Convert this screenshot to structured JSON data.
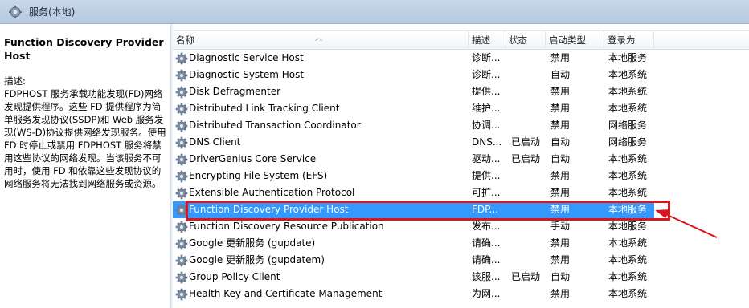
{
  "window": {
    "title": "服务(本地)"
  },
  "left_pane": {
    "service_title": "Function Discovery Provider Host",
    "desc_label": "描述:",
    "desc_text": "FDPHOST 服务承载功能发现(FD)网络发现提供程序。这些 FD 提供程序为简单服务发现协议(SSDP)和 Web 服务发现(WS-D)协议提供网络发现服务。使用 FD 时停止或禁用 FDPHOST 服务将禁用这些协议的网络发现。当该服务不可用时，使用 FD 和依靠这些发现协议的网络服务将无法找到网络服务或资源。"
  },
  "columns": {
    "name": "名称",
    "description": "描述",
    "status": "状态",
    "startup_type": "启动类型",
    "logon_as": "登录为"
  },
  "services": [
    {
      "name": "Diagnostic Service Host",
      "description": "诊断...",
      "status": "",
      "startup": "禁用",
      "logon": "本地服务"
    },
    {
      "name": "Diagnostic System Host",
      "description": "诊断...",
      "status": "",
      "startup": "自动",
      "logon": "本地系统"
    },
    {
      "name": "Disk Defragmenter",
      "description": "提供...",
      "status": "",
      "startup": "禁用",
      "logon": "本地系统"
    },
    {
      "name": "Distributed Link Tracking Client",
      "description": "维护...",
      "status": "",
      "startup": "禁用",
      "logon": "本地系统"
    },
    {
      "name": "Distributed Transaction Coordinator",
      "description": "协调...",
      "status": "",
      "startup": "禁用",
      "logon": "网络服务"
    },
    {
      "name": "DNS Client",
      "description": "DNS...",
      "status": "已启动",
      "startup": "自动",
      "logon": "网络服务"
    },
    {
      "name": "DriverGenius Core Service",
      "description": "驱动...",
      "status": "已启动",
      "startup": "自动",
      "logon": "本地系统"
    },
    {
      "name": "Encrypting File System (EFS)",
      "description": "提供...",
      "status": "",
      "startup": "禁用",
      "logon": "本地系统"
    },
    {
      "name": "Extensible Authentication Protocol",
      "description": "可扩...",
      "status": "",
      "startup": "禁用",
      "logon": "本地系统"
    },
    {
      "name": "Function Discovery Provider Host",
      "description": "FDP...",
      "status": "",
      "startup": "禁用",
      "logon": "本地服务"
    },
    {
      "name": "Function Discovery Resource Publication",
      "description": "发布...",
      "status": "",
      "startup": "手动",
      "logon": "本地服务"
    },
    {
      "name": "Google 更新服务 (gupdate)",
      "description": "请确...",
      "status": "",
      "startup": "禁用",
      "logon": "本地系统"
    },
    {
      "name": "Google 更新服务 (gupdatem)",
      "description": "请确...",
      "status": "",
      "startup": "禁用",
      "logon": "本地系统"
    },
    {
      "name": "Group Policy Client",
      "description": "该服...",
      "status": "已启动",
      "startup": "自动",
      "logon": "本地系统"
    },
    {
      "name": "Health Key and Certificate Management",
      "description": "为网...",
      "status": "",
      "startup": "禁用",
      "logon": "本地系统"
    }
  ],
  "colors": {
    "selection": "#3399ff",
    "highlight_box": "#d7171f",
    "arrow": "#d7171f"
  },
  "icons": {
    "service_row": "gear-icon",
    "title": "services-icon"
  }
}
